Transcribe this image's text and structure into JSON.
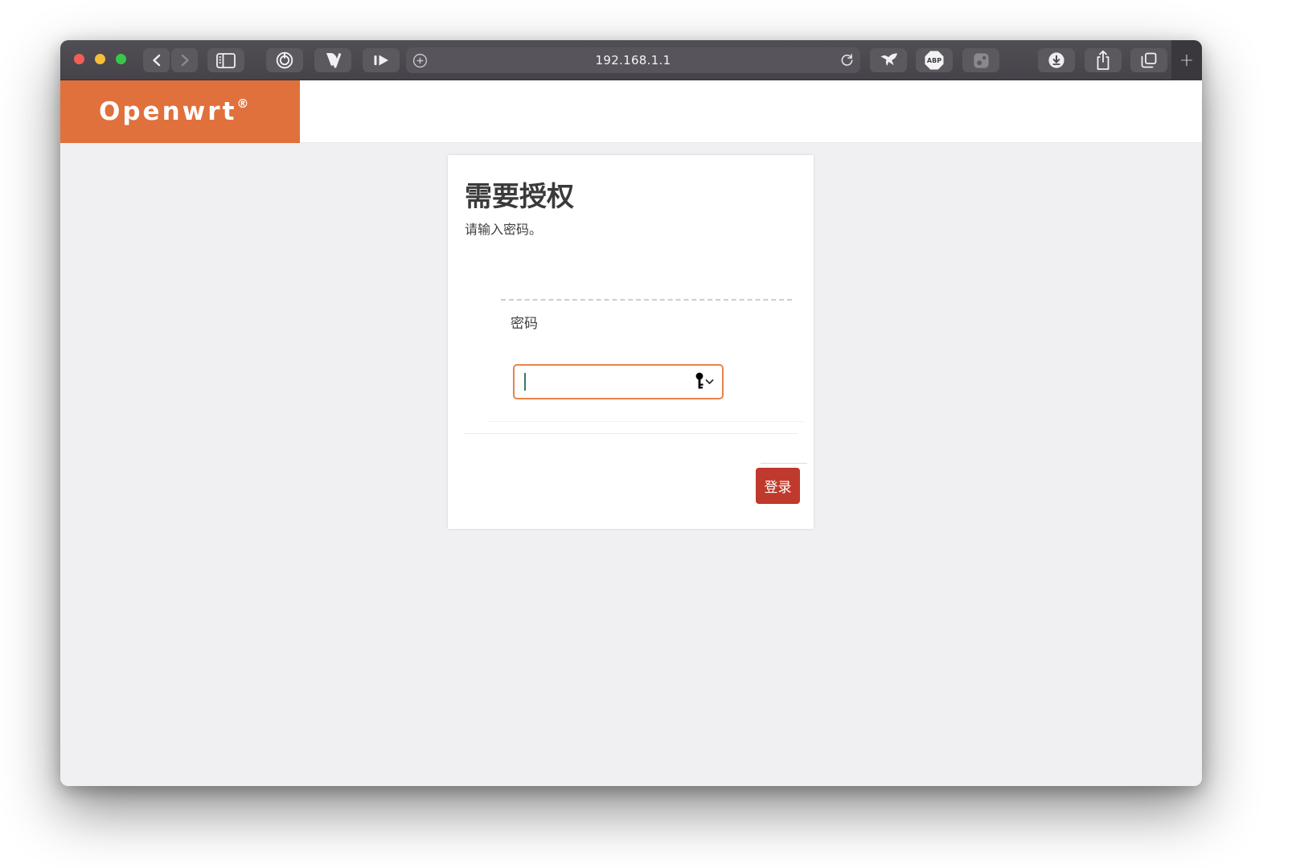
{
  "browser": {
    "url": "192.168.1.1",
    "new_tab_label": "+",
    "abp_label": "ABP",
    "icons": {
      "traffic_lights": [
        "close",
        "minimize",
        "fullscreen"
      ],
      "nav": [
        "back-chevron",
        "forward-chevron",
        "sidebar-panel"
      ],
      "extensions_left": [
        "onepassword-ring",
        "vd-extension",
        "fastforward-play"
      ],
      "url_field": [
        "circled-plus",
        "reload-arrow"
      ],
      "extensions_right": [
        "bird-extension",
        "adblock-plus-octagon",
        "dimmed-extension"
      ],
      "window_actions": [
        "download-circle",
        "share-arrow",
        "tab-overview"
      ]
    }
  },
  "site_header": {
    "logo_text": "Openwrt",
    "logo_mark": "®"
  },
  "login_card": {
    "title": "需要授权",
    "subtitle": "请输入密码。",
    "password_label": "密码",
    "password_value": "",
    "password_autofill_icon": "key-autofill",
    "submit_label": "登录"
  },
  "colors": {
    "brand_orange": "#e0703c",
    "submit_red": "#bf3a2c",
    "input_border_orange": "#e8834b",
    "caret_teal": "#2f7d6d",
    "toolbar_dark": "#4b494e",
    "page_background": "#f0f0f3"
  }
}
